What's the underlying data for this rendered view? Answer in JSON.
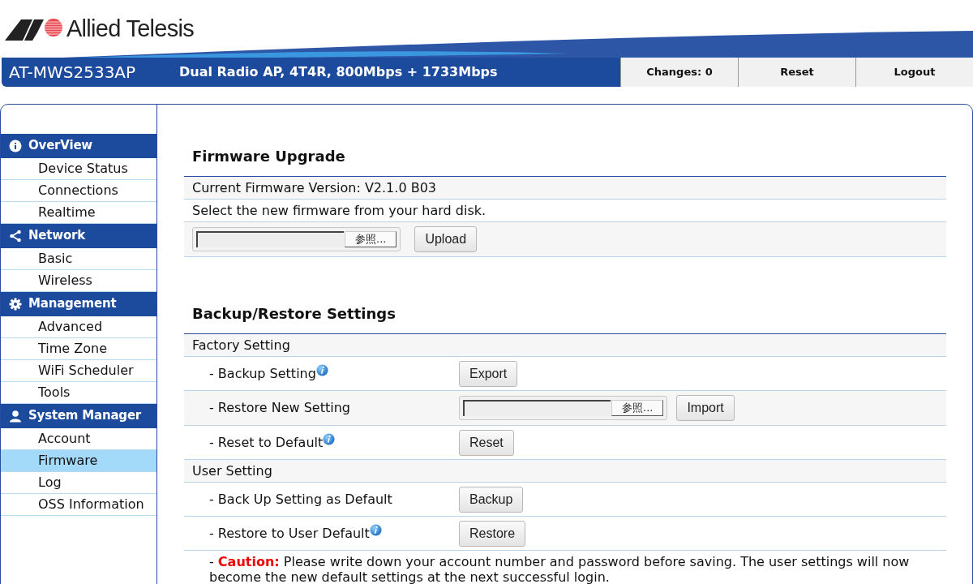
{
  "logo": {
    "text": "Allied Telesis"
  },
  "header": {
    "model": "AT-MWS2533AP",
    "description": "Dual Radio AP, 4T4R, 800Mbps + 1733Mbps",
    "buttons": [
      "Changes: 0",
      "Reset",
      "Logout"
    ]
  },
  "sidebar": [
    {
      "title": "OverView",
      "items": [
        {
          "label": "Device Status",
          "selected": false
        },
        {
          "label": "Connections",
          "selected": false
        },
        {
          "label": "Realtime",
          "selected": false
        }
      ]
    },
    {
      "title": "Network",
      "items": [
        {
          "label": "Basic",
          "selected": false
        },
        {
          "label": "Wireless",
          "selected": false
        }
      ]
    },
    {
      "title": "Management",
      "items": [
        {
          "label": "Advanced",
          "selected": false
        },
        {
          "label": "Time Zone",
          "selected": false
        },
        {
          "label": "WiFi Scheduler",
          "selected": false
        },
        {
          "label": "Tools",
          "selected": false
        }
      ]
    },
    {
      "title": "System Manager",
      "items": [
        {
          "label": "Account",
          "selected": false
        },
        {
          "label": "Firmware",
          "selected": true
        },
        {
          "label": "Log",
          "selected": false
        },
        {
          "label": "OSS Information",
          "selected": false
        }
      ]
    }
  ],
  "firmware_upgrade": {
    "title": "Firmware Upgrade",
    "current_version": "Current Firmware Version: V2.1.0 B03",
    "instruction": "Select the new firmware from your hard disk.",
    "browse_button": "参照...",
    "upload_button": "Upload"
  },
  "backup_restore": {
    "title": "Backup/Restore Settings",
    "rows": [
      {
        "kind": "group",
        "label": "Factory Setting"
      },
      {
        "kind": "action",
        "label": "- Backup Setting",
        "info": true,
        "button": "Export"
      },
      {
        "kind": "file",
        "label": "- Restore New Setting",
        "info": false,
        "browse_button": "参照...",
        "button": "Import"
      },
      {
        "kind": "action",
        "label": "- Reset to Default",
        "info": true,
        "button": "Reset"
      },
      {
        "kind": "group",
        "label": "User Setting"
      },
      {
        "kind": "action",
        "label": "- Back Up Setting as Default",
        "info": false,
        "button": "Backup"
      },
      {
        "kind": "action",
        "label": "- Restore to User Default",
        "info": true,
        "button": "Restore"
      }
    ],
    "caution": "- **Caution:** Please write down your account number and password before saving. The user settings will now become the new default settings at the next successful login."
  }
}
